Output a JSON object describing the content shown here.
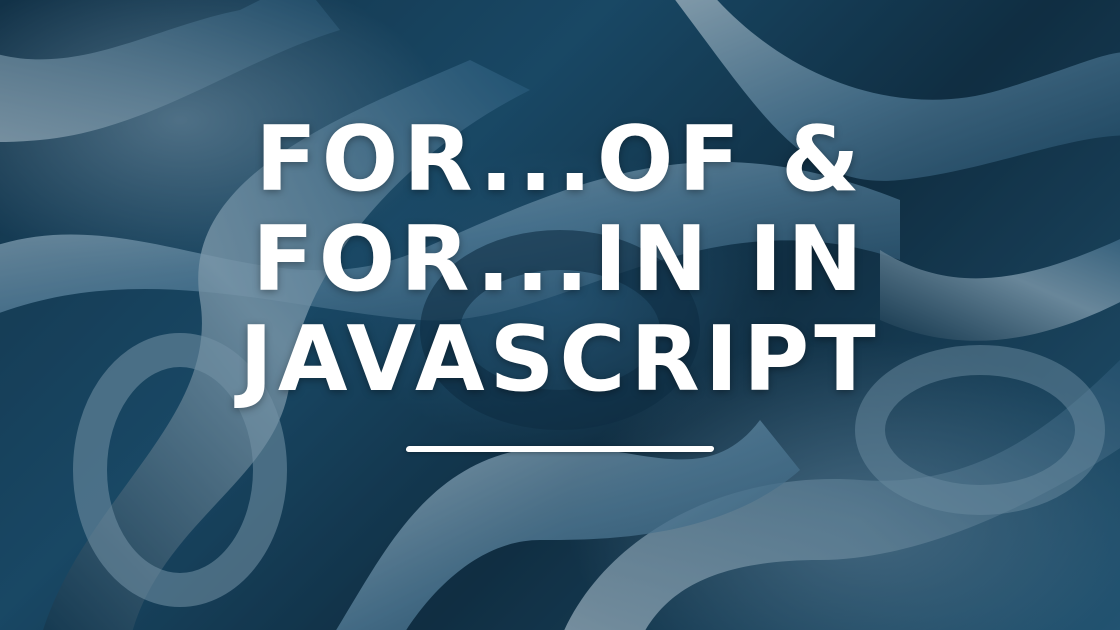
{
  "title": {
    "lines": [
      "FOR...OF &",
      "FOR...IN IN",
      "JAVASCRIPT"
    ]
  },
  "colors": {
    "title_text": "#ffffff",
    "underline": "#ffffff",
    "background_primary": "#1f5677",
    "background_dark": "#0e2a3c",
    "ribbon_highlight": "#b9d3e3"
  }
}
